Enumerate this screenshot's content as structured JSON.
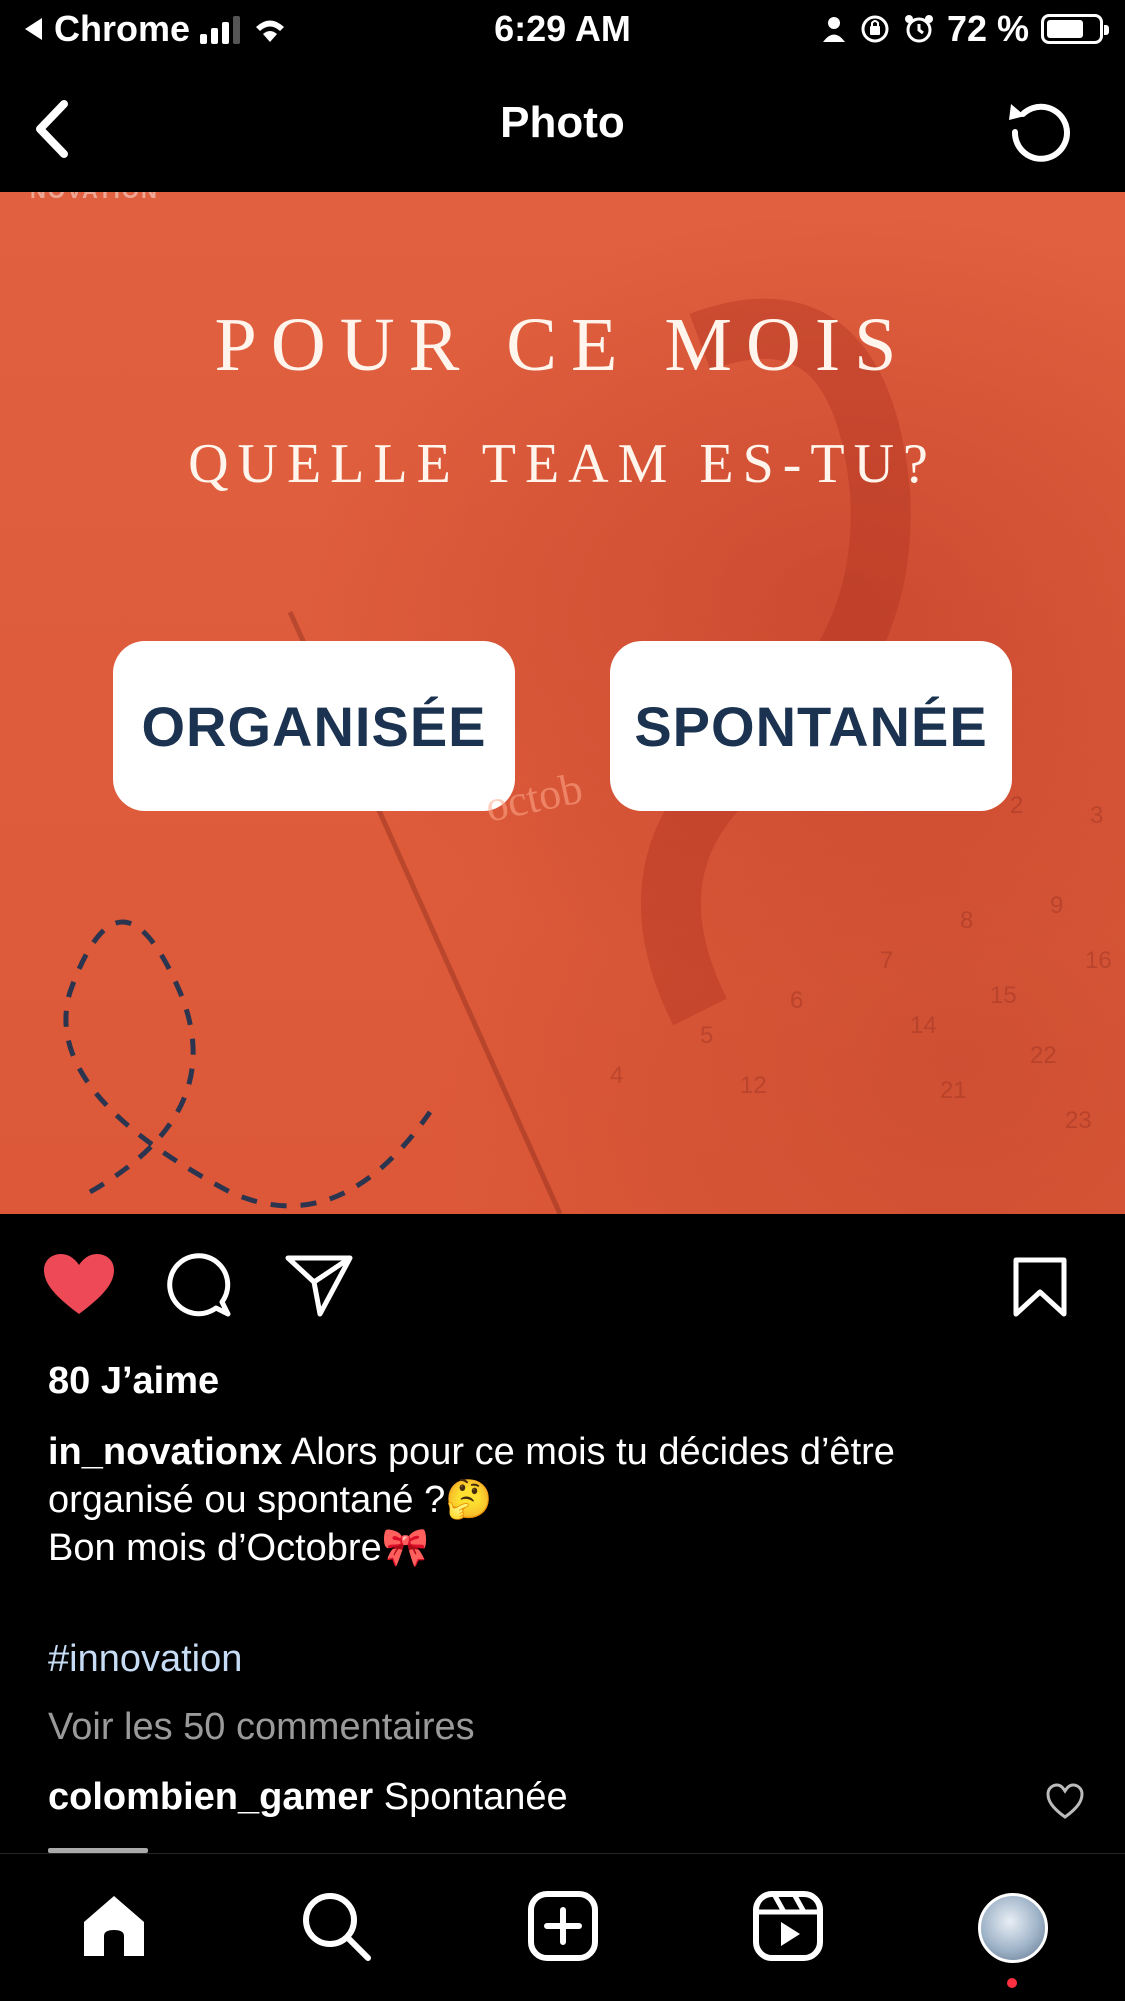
{
  "status_bar": {
    "back_app": "Chrome",
    "time": "6:29 AM",
    "battery": "72 %",
    "battery_level": 0.72
  },
  "header": {
    "title": "Photo",
    "back_icon": "chevron-left-icon",
    "refresh_icon": "refresh-icon"
  },
  "post_image": {
    "brand": "NOVATION",
    "headline": "POUR CE MOIS",
    "subline": "QUELLE TEAM ES-TU?",
    "option_left": "ORGANISÉE",
    "option_right": "SPONTANÉE",
    "calendar_word": "octob",
    "background_color": "#dd5a3a",
    "button_text_color": "#1b3350"
  },
  "actions": {
    "like_icon": "heart-filled-icon",
    "like_color": "#ed4956",
    "comment_icon": "comment-icon",
    "share_icon": "send-icon",
    "save_icon": "bookmark-icon"
  },
  "likes": "80 J’aime",
  "caption": {
    "username": "in_novationx",
    "text_line1": "Alors pour ce mois tu décides d’être",
    "text_line2": "organisé ou spontané ?🤔",
    "text_line3": "Bon mois d’Octobre🎀"
  },
  "hashtag": "#innovation",
  "view_comments": "Voir les 50 commentaires",
  "comment": {
    "username": "colombien_gamer",
    "text": "Spontanée"
  },
  "tab_bar": {
    "items": [
      "home-icon",
      "search-icon",
      "new-post-icon",
      "reels-icon",
      "profile-avatar"
    ]
  }
}
